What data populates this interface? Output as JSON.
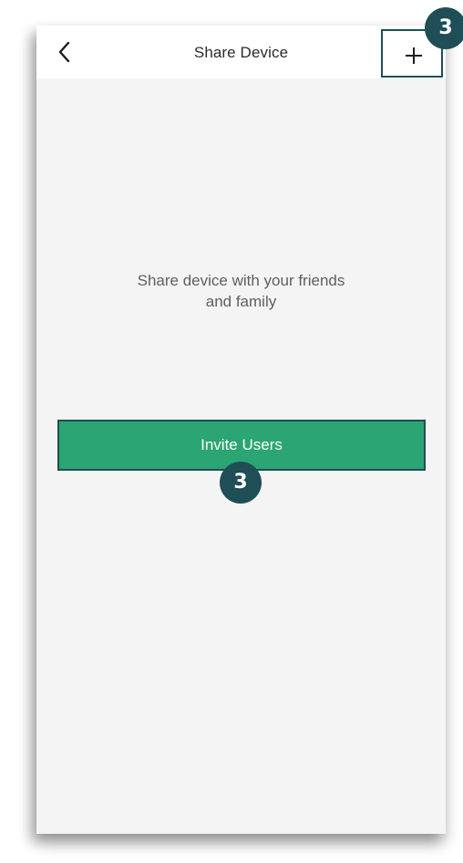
{
  "header": {
    "title": "Share Device",
    "back_icon": "chevron-left-icon",
    "add_icon": "plus-icon"
  },
  "main": {
    "message_line1": "Share device with your friends",
    "message_line2": "and family",
    "invite_button_label": "Invite Users"
  },
  "annotations": {
    "top_step_number": "3",
    "invite_step_number": "3"
  },
  "colors": {
    "accent_green": "#2ba573",
    "annotation_teal": "#1f4e57",
    "background": "#f4f4f4"
  }
}
